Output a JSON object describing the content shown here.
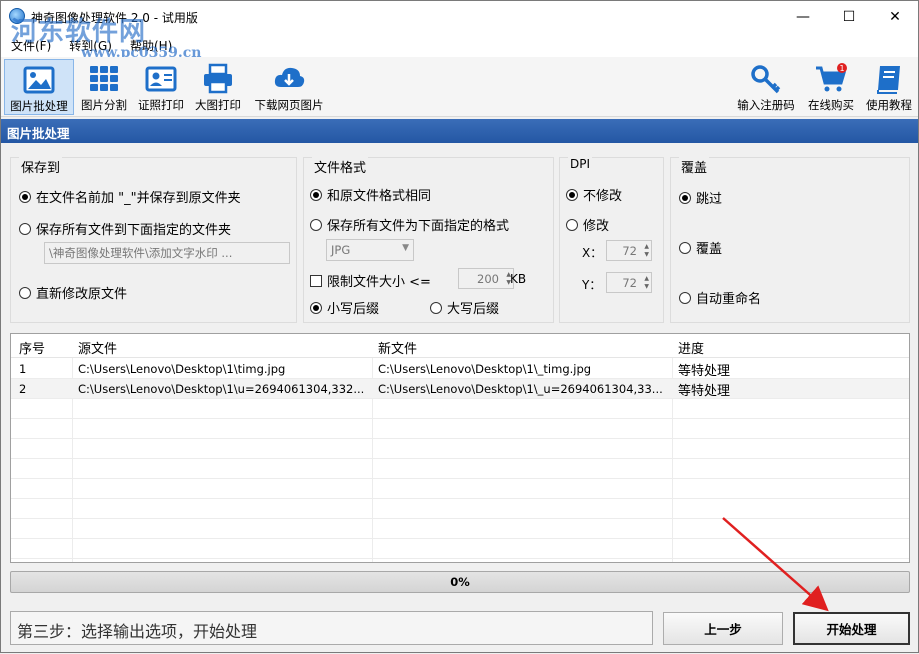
{
  "window": {
    "title": "神奇图像处理软件 2.0 - 试用版",
    "watermark": "河东软件网",
    "watermark_url": "www.pc0359.cn"
  },
  "menu": [
    "文件(F)",
    "转到(G)",
    "帮助(H)"
  ],
  "toolbar": {
    "left": [
      {
        "label": "图片批处理",
        "icon": "image-icon"
      },
      {
        "label": "图片分割",
        "icon": "grid-icon"
      },
      {
        "label": "证照打印",
        "icon": "id-card-icon"
      },
      {
        "label": "大图打印",
        "icon": "printer-icon"
      },
      {
        "label": "下载网页图片",
        "icon": "cloud-download-icon"
      }
    ],
    "right": [
      {
        "label": "输入注册码",
        "icon": "key-icon"
      },
      {
        "label": "在线购买",
        "icon": "cart-icon",
        "badge": "1"
      },
      {
        "label": "使用教程",
        "icon": "book-icon"
      }
    ]
  },
  "section_title": "图片批处理",
  "save_to": {
    "title": "保存到",
    "opt1": "在文件名前加 \"_\"并保存到原文件夹",
    "opt2": "保存所有文件到下面指定的文件夹",
    "folder_path": "\\神奇图像处理软件\\添加文字水印 ...",
    "opt3": "直新修改原文件"
  },
  "file_format": {
    "title": "文件格式",
    "opt1": "和原文件格式相同",
    "opt2": "保存所有文件为下面指定的格式",
    "format_value": "JPG",
    "limit_label": "限制文件大小 <=",
    "limit_value": "200",
    "limit_unit": "KB",
    "lower": "小写后缀",
    "upper": "大写后缀"
  },
  "dpi": {
    "title": "DPI",
    "opt1": "不修改",
    "opt2": "修改",
    "x_label": "X：",
    "x_value": "72",
    "y_label": "Y：",
    "y_value": "72"
  },
  "overwrite": {
    "title": "覆盖",
    "opt1": "跳过",
    "opt2": "覆盖",
    "opt3": "自动重命名"
  },
  "table": {
    "headers": [
      "序号",
      "源文件",
      "新文件",
      "进度"
    ],
    "rows": [
      {
        "no": "1",
        "src": "C:\\Users\\Lenovo\\Desktop\\1\\timg.jpg",
        "dst": "C:\\Users\\Lenovo\\Desktop\\1\\_timg.jpg",
        "status": "等特处理"
      },
      {
        "no": "2",
        "src": "C:\\Users\\Lenovo\\Desktop\\1\\u=2694061304,332...",
        "dst": "C:\\Users\\Lenovo\\Desktop\\1\\_u=2694061304,33...",
        "status": "等特处理"
      }
    ]
  },
  "progress": {
    "value": 0,
    "text": "0%"
  },
  "step_text": "第三步：选择输出选项，开始处理",
  "buttons": {
    "prev": "上一步",
    "start": "开始处理"
  },
  "colors": {
    "header_blue": "#2457a4",
    "annotation_arrow": "#e02020"
  }
}
